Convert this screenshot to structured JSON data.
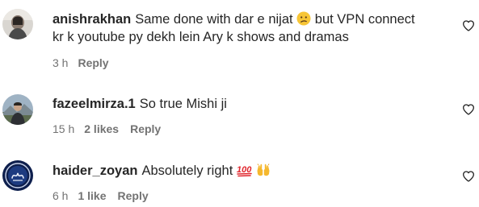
{
  "comments": [
    {
      "username": "anishrakhan",
      "text_line1_a": "Same done with dar e nijat",
      "emoji1": "confused-face-emoji",
      "text_line1_b": "but VPN connect",
      "text_line2": "kr k youtube py dekh lein Ary k shows and dramas",
      "time": "3 h",
      "likes": "",
      "reply_label": "Reply"
    },
    {
      "username": "fazeelmirza.1",
      "text": "So true Mishi ji",
      "time": "15 h",
      "likes": "2 likes",
      "reply_label": "Reply"
    },
    {
      "username": "haider_zoyan",
      "text": "Absolutely right",
      "emoji1": "hundred-points-emoji",
      "emoji2": "raising-hands-emoji",
      "time": "6 h",
      "likes": "1 like",
      "reply_label": "Reply"
    }
  ],
  "icons": {
    "like": "heart-outline-icon"
  },
  "colors": {
    "text": "#262626",
    "meta": "#737373",
    "background": "#ffffff"
  }
}
